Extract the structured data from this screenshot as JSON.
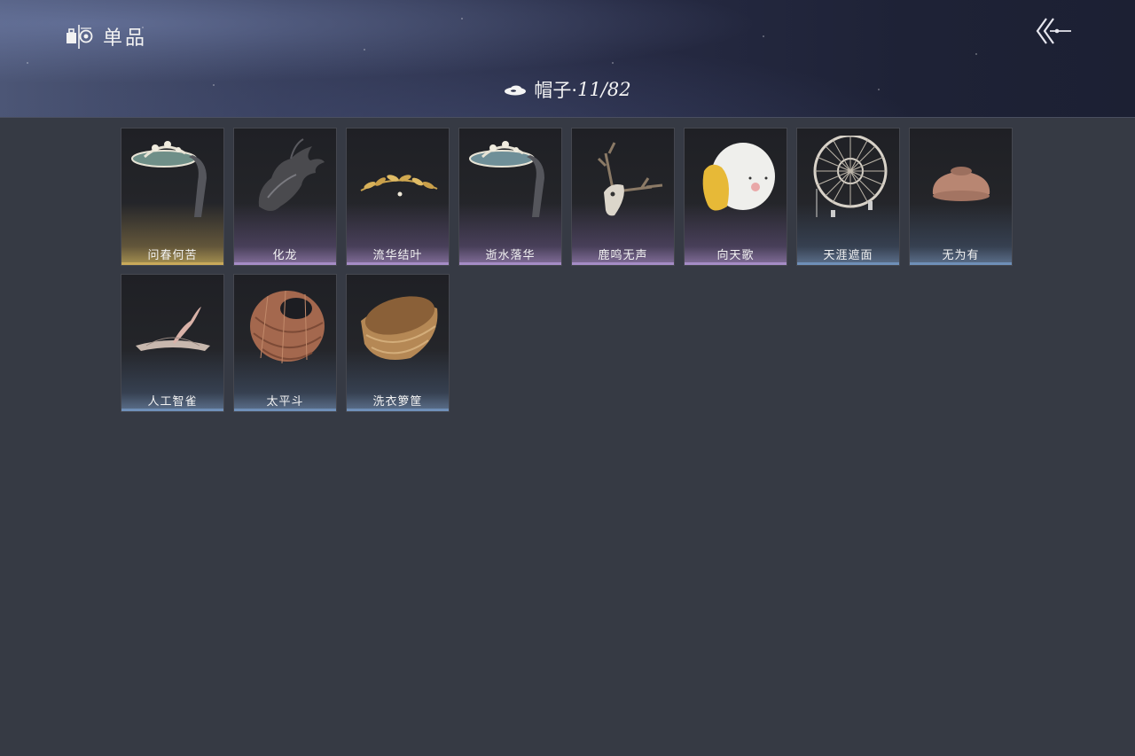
{
  "header": {
    "title": "单品",
    "title_icon": "wardrobe-icon",
    "back_icon": "back-arrows-icon"
  },
  "category": {
    "icon": "hat-icon",
    "label": "帽子·",
    "count": "11/82"
  },
  "rarity_colors": {
    "gold": "#c9a95a",
    "purple": "#a58cc6",
    "blue": "#6f8fb8"
  },
  "items": [
    {
      "name": "问春何苦",
      "rarity": "gold",
      "icon": "veiled-crown-hat-icon"
    },
    {
      "name": "化龙",
      "rarity": "purple",
      "icon": "dragon-headpiece-icon"
    },
    {
      "name": "流华结叶",
      "rarity": "purple",
      "icon": "golden-leaf-wreath-icon"
    },
    {
      "name": "逝水落华",
      "rarity": "purple",
      "icon": "veiled-crown-hat-icon"
    },
    {
      "name": "鹿鸣无声",
      "rarity": "purple",
      "icon": "deer-skull-icon"
    },
    {
      "name": "向天歌",
      "rarity": "purple",
      "icon": "goose-hood-icon"
    },
    {
      "name": "天涯遮面",
      "rarity": "blue",
      "icon": "woven-veil-hat-icon"
    },
    {
      "name": "无为有",
      "rarity": "blue",
      "icon": "clay-bowl-hat-icon"
    },
    {
      "name": "人工智雀",
      "rarity": "blue",
      "icon": "bird-rope-hat-icon"
    },
    {
      "name": "太平斗",
      "rarity": "blue",
      "icon": "wicker-basket-hat-icon"
    },
    {
      "name": "洗衣箩筐",
      "rarity": "blue",
      "icon": "laundry-basket-hat-icon"
    }
  ]
}
